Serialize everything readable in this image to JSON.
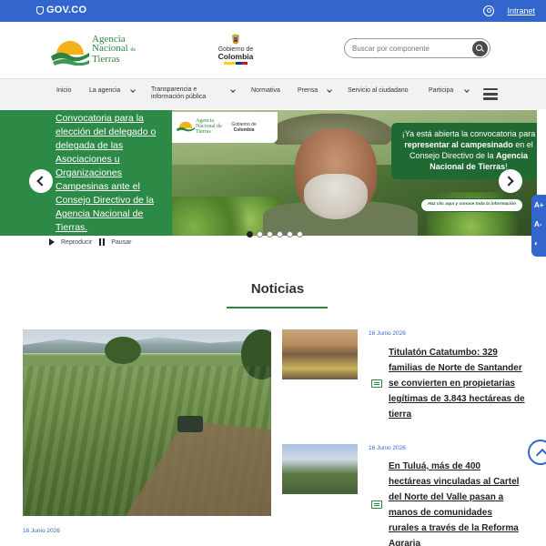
{
  "govbar": {
    "brand": "GOV.CO",
    "intranet": "Intranet"
  },
  "header": {
    "logo": {
      "line1": "Agencia",
      "line2": "Nacional",
      "line2_suffix": "de",
      "line3": "Tierras"
    },
    "gov_logo": {
      "line1": "Gobierno de",
      "line2": "Colombia"
    },
    "search_placeholder": "Buscar por componente"
  },
  "nav": {
    "items": [
      {
        "label": "Inicio"
      },
      {
        "label": "La agencia"
      },
      {
        "label": "Transparencia e información pública"
      },
      {
        "label": "Normativa"
      },
      {
        "label": "Prensa"
      },
      {
        "label": "Servicio al ciudadano"
      },
      {
        "label": "Participa"
      }
    ]
  },
  "hero": {
    "headline": "Convocatoria para la elección del delegado o delegada de las Asociaciones u Organizaciones Campesinas ante el Consejo Directivo de la Agencia Nacional de Tierras.",
    "banner": {
      "logo_line1": "Agencia",
      "logo_line2": "Nacional de",
      "logo_line3": "Tierras",
      "gov_line1": "Gobierno de",
      "gov_line2": "Colombia",
      "card_part1": "¡Ya está abierta la convocatoria para ",
      "card_bold1": "representar al campesinado",
      "card_part2": " en el Consejo Directivo de la ",
      "card_bold2": "Agencia Nacional de Tierras",
      "card_part3": "!",
      "cta": "Haz clic aquí y conoce toda la información"
    },
    "slides_total": 6,
    "active_slide": 1,
    "controls": {
      "play": "Reproducir",
      "pause": "Pausar"
    }
  },
  "accessibility": {
    "increase": "A+",
    "decrease": "A-",
    "contrast": "◐"
  },
  "news": {
    "title": "Noticias",
    "featured_date": "16 Junio 2026",
    "items": [
      {
        "date": "16 Junio 2026",
        "title": "Titulatón Catatumbo: 329 familias de Norte de Santander se convierten en propietarias legítimas de 3.843 hectáreas de tierra"
      },
      {
        "date": "16 Junio 2026",
        "title": "En Tuluá, más de 400 hectáreas vinculadas al Cartel del Norte del Valle pasan a manos de comunidades rurales a través de la Reforma Agraria"
      }
    ]
  }
}
